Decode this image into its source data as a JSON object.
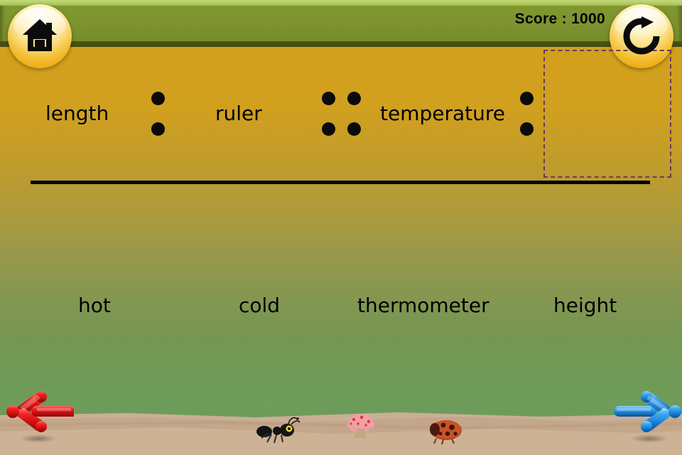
{
  "app": {
    "title": "Analogies Quiz",
    "background_top_color": "#d3a01c",
    "background_bottom_color": "#6d9c5a",
    "topbar_color": "#7d9330",
    "accent_color": "#f5c23c"
  },
  "topbar": {
    "score_text": "Score : 1000",
    "score_label": "Score",
    "score_value": "1000",
    "home_button": {
      "icon": "home-icon",
      "label": "Home"
    },
    "reload_button": {
      "icon": "refresh-icon",
      "label": "Restart"
    }
  },
  "question": {
    "type": "analogy",
    "term_1": "length",
    "term_2": "ruler",
    "term_3": "temperature",
    "answer_slot": "",
    "separator_1": ":",
    "separator_2": "::",
    "separator_3": ":",
    "dropzone_border_color": "#6b3a5c",
    "dropzone_hint": ""
  },
  "options": {
    "items": [
      {
        "label": "hot"
      },
      {
        "label": "cold"
      },
      {
        "label": "thermometer"
      },
      {
        "label": "height"
      }
    ]
  },
  "navigation": {
    "prev": {
      "label": "Previous",
      "icon": "arrow-left-icon",
      "color": "#d81717"
    },
    "next": {
      "label": "Next",
      "icon": "arrow-right-icon",
      "color": "#1f8fe0"
    }
  },
  "scene": {
    "ground_color": "#c8ad92",
    "items": [
      {
        "name": "ant"
      },
      {
        "name": "mushroom"
      },
      {
        "name": "ladybug"
      }
    ]
  }
}
